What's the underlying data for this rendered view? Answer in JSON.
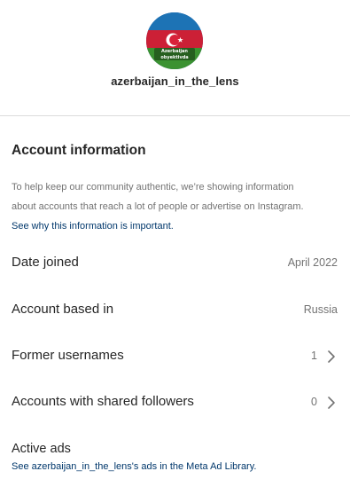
{
  "profile": {
    "username": "azerbaijan_in_the_lens",
    "avatar_caption_line1": "Azerbaijan",
    "avatar_caption_line2": "obyektivda"
  },
  "account_info": {
    "title": "Account information",
    "description_line1": "To help keep our community authentic, we’re showing information",
    "description_line2": "about accounts that reach a lot of people or advertise on Instagram.",
    "description_prefix": "See ",
    "description_link": "why this information is important."
  },
  "rows": {
    "date_joined": {
      "label": "Date joined",
      "value": "April 2022"
    },
    "account_based_in": {
      "label": "Account based in",
      "value": "Russia"
    },
    "former_usernames": {
      "label": "Former usernames",
      "value": "1"
    },
    "shared_followers": {
      "label": "Accounts with shared followers",
      "value": "0"
    }
  },
  "active_ads": {
    "label": "Active ads",
    "link": "See azerbaijan_in_the_lens's ads in the Meta Ad Library."
  },
  "colors": {
    "text_primary": "#262626",
    "text_secondary": "#737373",
    "link": "#00376b",
    "divider": "#dbdbdb",
    "flag_blue": "#1f7bc1",
    "flag_red": "#d9223a",
    "flag_green": "#3f9c35"
  },
  "icons": {
    "chevron": "chevron-right-icon",
    "avatar_flag": "azerbaijan-flag-icon"
  }
}
